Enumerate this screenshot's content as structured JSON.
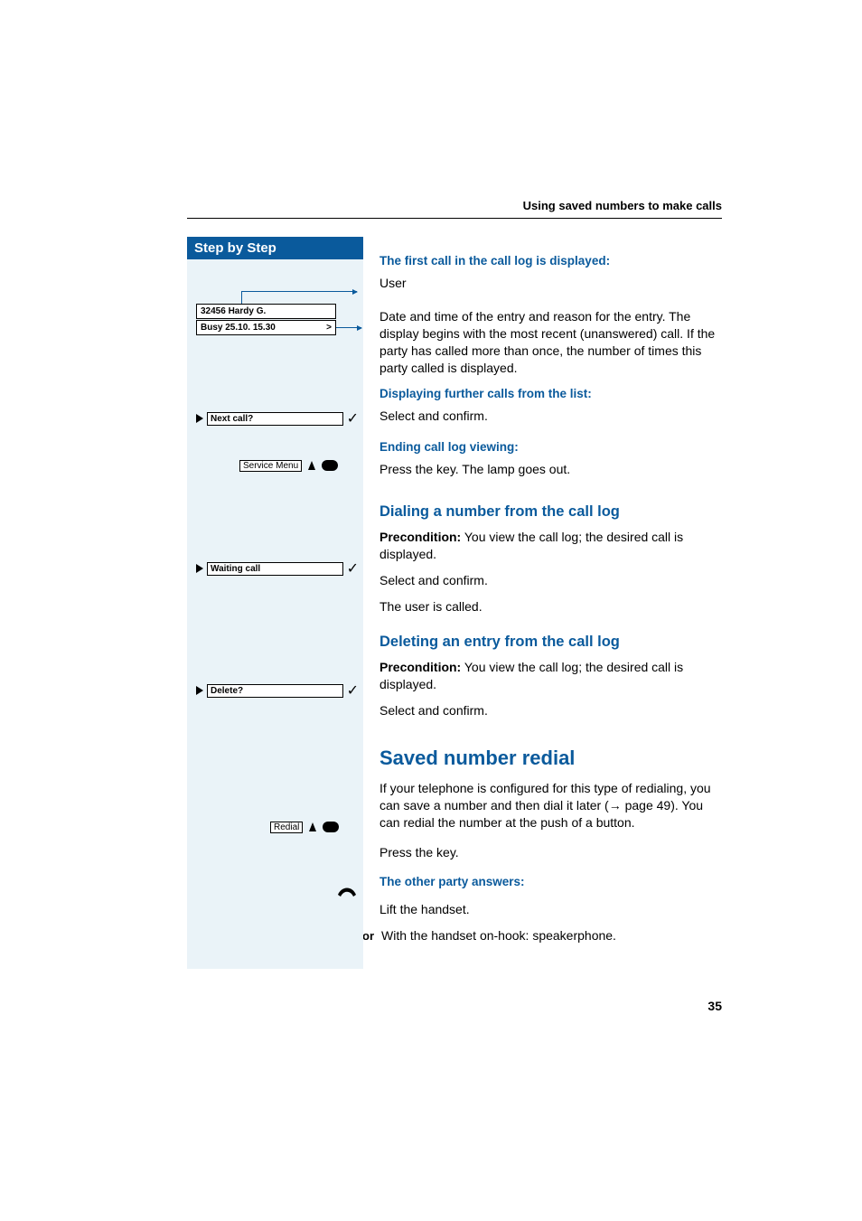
{
  "header": "Using saved numbers to make calls",
  "sidebar": {
    "title": "Step by Step",
    "display_line1": "32456 Hardy G.",
    "display_line2": "Busy 25.10. 15.30",
    "display_arrow": ">",
    "option_next_call": "Next call?",
    "option_waiting_call": "Waiting call",
    "option_delete": "Delete?",
    "key_service_menu": "Service Menu",
    "key_redial": "Redial"
  },
  "content": {
    "s1_title": "The first call in the call log is displayed:",
    "s1_user": "User",
    "s1_para": "Date and time of the entry and reason for the entry. The display begins with the most recent (unanswered) call. If the party has called more than once, the number of times this party called is displayed.",
    "s2_title": "Displaying further calls from the list:",
    "s2_text": "Select and confirm.",
    "s3_title": "Ending call log viewing:",
    "s3_text": "Press the key. The lamp goes out.",
    "h2a": "Dialing a number from the call log",
    "h2a_pre_label": "Precondition:",
    "h2a_pre_text": " You view the call log; the desired call is displayed.",
    "h2a_sel": "Select and confirm.",
    "h2a_called": "The user is called.",
    "h2b": "Deleting an entry from the call log",
    "h2b_pre_label": "Precondition:",
    "h2b_pre_text": " You view the call log; the desired call is displayed.",
    "h2b_sel": "Select and confirm.",
    "h1": "Saved number redial",
    "h1_para1_a": "If your telephone is configured for this type of redialing, you can save a number and then dial it later (",
    "h1_para1_arrow": "→",
    "h1_para1_b": " page 49). You can redial the number at the push of a button.",
    "h1_press": "Press the key.",
    "s4_title": "The other party answers:",
    "s4_lift": "Lift the handset.",
    "or_label": "or",
    "s4_sp": "With the handset on-hook: speakerphone."
  },
  "page_number": "35"
}
